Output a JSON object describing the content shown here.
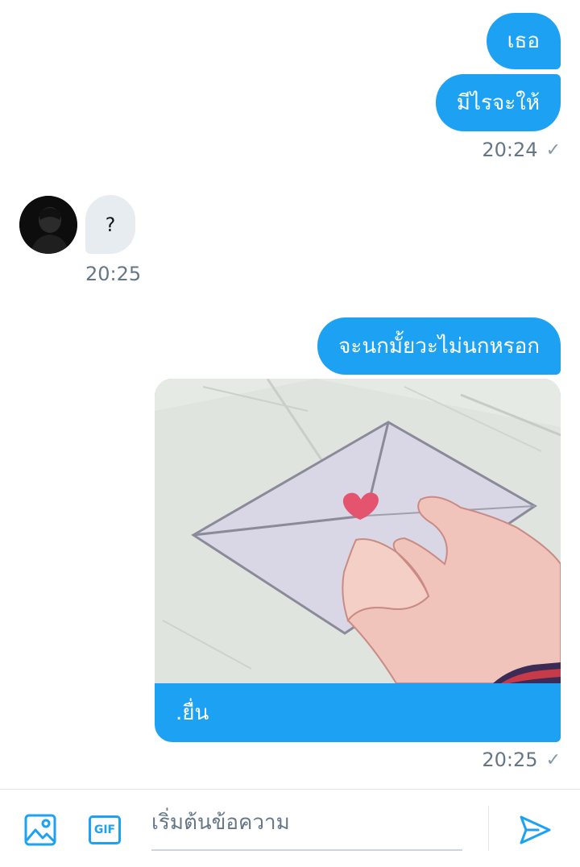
{
  "messages": {
    "m1": {
      "text": "เธอ"
    },
    "m2": {
      "text": "มีไรจะให้",
      "time": "20:24"
    },
    "m3": {
      "text": "?",
      "time": "20:25"
    },
    "m4": {
      "text": "จะนกมั้ยวะไม่นกหรอก"
    },
    "m5": {
      "caption": ".ยื่น",
      "time": "20:25"
    }
  },
  "composer": {
    "placeholder": "เริ่มต้นข้อความ",
    "gif_label": "GIF"
  },
  "colors": {
    "accent": "#1da1f2",
    "incoming_bubble": "#e6ecf0",
    "timestamp": "#657786"
  },
  "icons": {
    "image": "image-icon",
    "gif": "gif-icon",
    "send": "send-icon",
    "read": "check-icon"
  }
}
